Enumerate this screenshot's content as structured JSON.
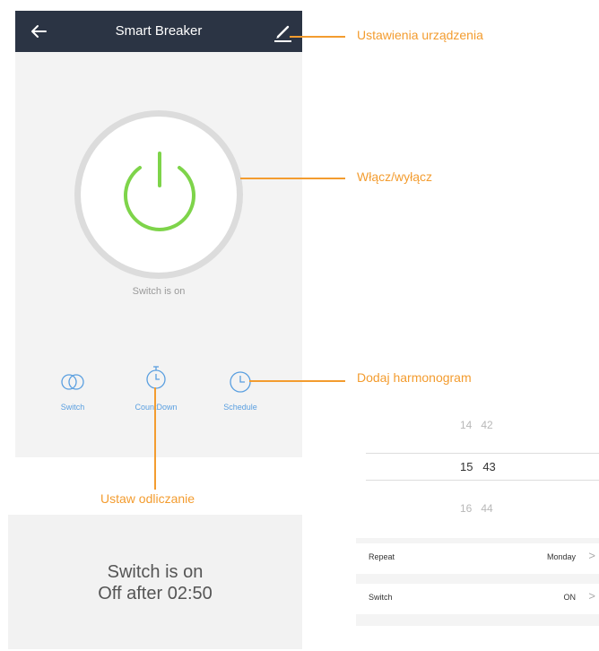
{
  "app": {
    "title": "Smart Breaker",
    "status": "Switch is on",
    "buttons": [
      {
        "label": "Switch",
        "icon": "toggle-icon"
      },
      {
        "label": "CountDown",
        "icon": "stopwatch-icon"
      },
      {
        "label": "Schedule",
        "icon": "clock-icon"
      }
    ]
  },
  "callouts": {
    "settings": "Ustawienia urządzenia",
    "toggle": "Włącz/wyłącz",
    "schedule": "Dodaj harmonogram",
    "countdown": "Ustaw odliczanie"
  },
  "countdown": {
    "line1": "Switch is on",
    "line2": "Off after 02:50"
  },
  "picker": {
    "rows": [
      {
        "hour": "14",
        "minute": "42"
      },
      {
        "hour": "15",
        "minute": "43"
      },
      {
        "hour": "16",
        "minute": "44"
      }
    ]
  },
  "settings": {
    "repeat_label": "Repeat",
    "repeat_value": "Monday",
    "switch_label": "Switch",
    "switch_value": "ON",
    "chevron": ">"
  },
  "colors": {
    "topbar": "#2b3444",
    "accent": "#f39c2f",
    "power_green": "#7ed44a",
    "button_blue": "#5a9fe0"
  }
}
